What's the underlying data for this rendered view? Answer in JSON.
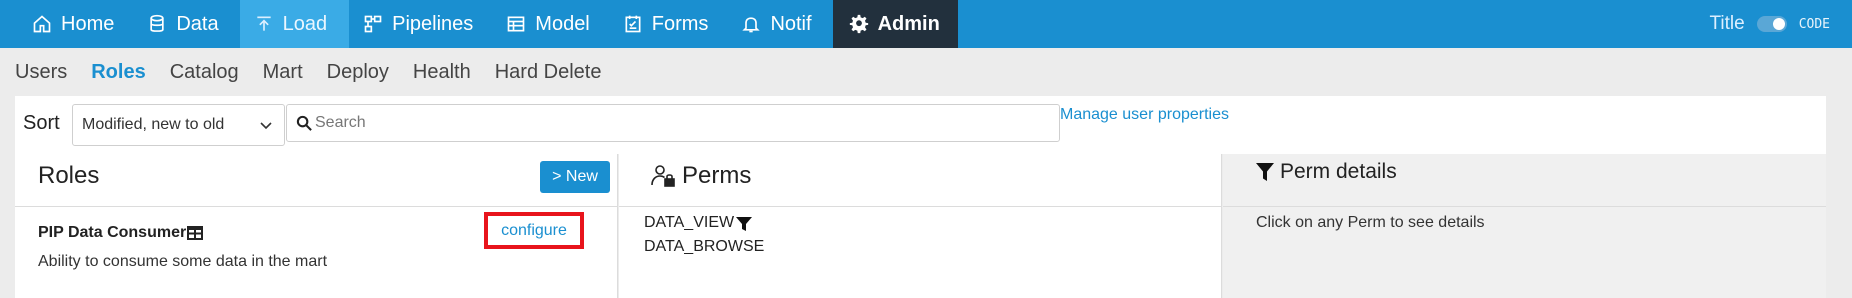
{
  "nav": {
    "items": [
      {
        "label": "Home",
        "icon": "home-icon"
      },
      {
        "label": "Data",
        "icon": "database-icon"
      },
      {
        "label": "Load",
        "icon": "upload-icon"
      },
      {
        "label": "Pipelines",
        "icon": "pipelines-icon"
      },
      {
        "label": "Model",
        "icon": "model-icon"
      },
      {
        "label": "Forms",
        "icon": "forms-icon"
      },
      {
        "label": "Notif",
        "icon": "bell-icon"
      },
      {
        "label": "Admin",
        "icon": "gear-icon"
      }
    ],
    "active": "Admin",
    "highlighted": "Load",
    "title_label": "Title",
    "code_label": "CODE",
    "colors": {
      "bar": "#1a8fd0",
      "load": "#3aabe6",
      "admin": "#22303d"
    }
  },
  "subnav": {
    "items": [
      "Users",
      "Roles",
      "Catalog",
      "Mart",
      "Deploy",
      "Health",
      "Hard Delete"
    ],
    "active": "Roles"
  },
  "toolbar": {
    "sort_label": "Sort",
    "sort_value": "Modified, new to old",
    "search_placeholder": "Search",
    "search_value": "",
    "manage_link": "Manage user properties"
  },
  "roles": {
    "title": "Roles",
    "new_button": "> New",
    "items": [
      {
        "name": "PIP Data Consumer",
        "description": "Ability to consume some data in the mart",
        "action": "configure"
      }
    ]
  },
  "perms": {
    "title": "Perms",
    "items": [
      "DATA_VIEW",
      "DATA_BROWSE"
    ]
  },
  "details": {
    "title": "Perm details",
    "hint": "Click on any Perm to see details"
  }
}
